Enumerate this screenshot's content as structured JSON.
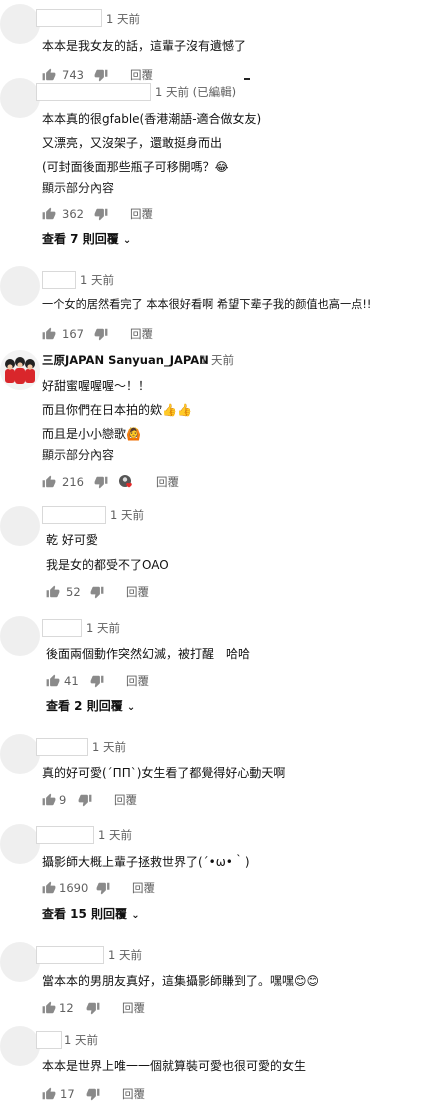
{
  "colors": {
    "icon": "#8a8a8a",
    "text_secondary": "#606060",
    "heart": "#e32b2b",
    "brand_red": "#d9262b"
  },
  "icons": {
    "like": "thumb-up-icon",
    "dislike": "thumb-down-icon",
    "chevron": "chevron-down-icon",
    "heart": "heart-icon"
  },
  "labels": {
    "reply": "回覆",
    "show_more": "顯示部分內容"
  },
  "comments": [
    {
      "author": "",
      "time": "1 天前",
      "lines": [
        "本本是我女友的話，這輩子沒有遺憾了"
      ],
      "likes": "743"
    },
    {
      "author": "",
      "time": "1 天前 (已編輯)",
      "lines": [
        "本本真的很gfable(香港潮語-適合做女友)",
        "又漂亮，又沒架子，還敢挺身而出",
        "(可封面後面那些瓶子可移開嗎？😂"
      ],
      "likes": "362",
      "view_replies": "查看 7 則回覆"
    },
    {
      "author": "",
      "time": "1 天前",
      "lines": [
        "一个女的居然看完了 本本很好看啊 希望下辈子我的颜值也高一点!!"
      ],
      "likes": "167"
    },
    {
      "author": "三原JAPAN Sanyuan_JAPAN",
      "time": "1 天前",
      "lines": [
        "好甜蜜喔喔喔～！！",
        "而且你們在日本拍的欸👍👍",
        "而且是小小戀歌🙆"
      ],
      "likes": "216"
    },
    {
      "author": "",
      "time": "1 天前",
      "lines": [
        "乾 好可愛",
        "我是女的都受不了OAO"
      ],
      "likes": "52"
    },
    {
      "author": "",
      "time": "1 天前",
      "lines": [
        "後面兩個動作突然幻滅，被打醒　哈哈"
      ],
      "likes": "41",
      "view_replies": "查看 2 則回覆"
    },
    {
      "author": "",
      "time": "1 天前",
      "lines": [
        "真的好可愛(´ΠΠ`)女生看了都覺得好心動天啊"
      ],
      "likes": "9"
    },
    {
      "author": "",
      "time": "1 天前",
      "lines": [
        "攝影師大概上輩子拯救世界了(´•ω•｀)"
      ],
      "likes": "1690",
      "view_replies": "查看 15 則回覆"
    },
    {
      "author": "",
      "time": "1 天前",
      "lines": [
        "當本本的男朋友真好，這集攝影師賺到了。嘿嘿😊😊"
      ],
      "likes": "12"
    },
    {
      "author": "",
      "time": "1 天前",
      "lines": [
        "本本是世界上唯一一個就算裝可愛也很可愛的女生"
      ],
      "likes": "17"
    }
  ]
}
